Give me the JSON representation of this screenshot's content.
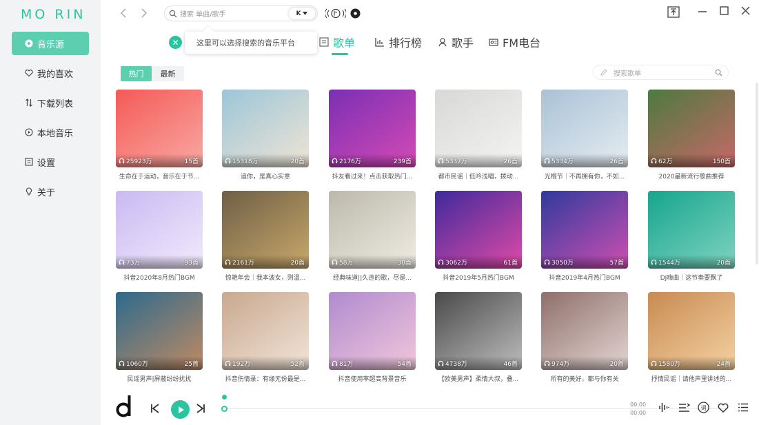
{
  "app": {
    "logo": "MO RIN"
  },
  "sidebar": {
    "items": [
      {
        "label": "音乐源",
        "icon": "disc-icon",
        "active": true
      },
      {
        "label": "我的喜欢",
        "icon": "heart-icon"
      },
      {
        "label": "下载列表",
        "icon": "sort-icon"
      },
      {
        "label": "本地音乐",
        "icon": "play-circle-icon"
      },
      {
        "label": "设置",
        "icon": "settings-icon"
      },
      {
        "label": "关于",
        "icon": "bulb-icon"
      }
    ]
  },
  "search": {
    "placeholder": "搜索 单曲/歌手",
    "source": "K"
  },
  "tooltip": {
    "text": "这里可以选择搜索的音乐平台"
  },
  "tabs": [
    {
      "label": "歌单",
      "icon": "playlist-icon",
      "active": true
    },
    {
      "label": "排行榜",
      "icon": "chart-icon"
    },
    {
      "label": "歌手",
      "icon": "singer-icon"
    },
    {
      "label": "FM电台",
      "icon": "radio-icon"
    }
  ],
  "filters": {
    "hot": "热门",
    "new": "最新"
  },
  "playlist_search": {
    "placeholder": "搜索歌单"
  },
  "playlists": [
    {
      "title": "生命在于运动，音乐在于节...",
      "plays": "25923万",
      "tracks": "15首",
      "colors": [
        "#f45a56",
        "#f9a8a3"
      ]
    },
    {
      "title": "追你，是真心实意",
      "plays": "15318万",
      "tracks": "20首",
      "colors": [
        "#9cc6d8",
        "#efe4d4"
      ]
    },
    {
      "title": "抖友看过来！点击获取热门...",
      "plays": "2176万",
      "tracks": "239首",
      "colors": [
        "#7b2fb3",
        "#d44ab5"
      ]
    },
    {
      "title": "都市民谣｜低吟浅唱，拨动...",
      "plays": "5337万",
      "tracks": "26首",
      "colors": [
        "#d8d8d6",
        "#f4f4f2"
      ]
    },
    {
      "title": "光棍节｜不再拥有你，不如...",
      "plays": "5334万",
      "tracks": "26首",
      "colors": [
        "#a9c2d6",
        "#e6ecf1"
      ]
    },
    {
      "title": "2020最新流行歌曲推荐",
      "plays": "62万",
      "tracks": "150首",
      "colors": [
        "#4c7a3e",
        "#c86868"
      ]
    },
    {
      "title": "抖音2020年8月热门BGM",
      "plays": "73万",
      "tracks": "93首",
      "colors": [
        "#c9b9f2",
        "#f2eafc"
      ]
    },
    {
      "title": "惊艳年会｜我本波女，则温...",
      "plays": "2161万",
      "tracks": "20首",
      "colors": [
        "#6e5f46",
        "#c9a86a"
      ]
    },
    {
      "title": "经典味道||久违的歌，尽是...",
      "plays": "58万",
      "tracks": "30首",
      "colors": [
        "#bcb9ac",
        "#efece2"
      ]
    },
    {
      "title": "抖音2019年5月热门BGM",
      "plays": "3062万",
      "tracks": "61首",
      "colors": [
        "#3f2a9a",
        "#e04aa8"
      ]
    },
    {
      "title": "抖音2019年4月热门BGM",
      "plays": "3050万",
      "tracks": "57首",
      "colors": [
        "#2f3a9c",
        "#cf4fb2"
      ]
    },
    {
      "title": "DJ嗨曲｜这节奏要飘了",
      "plays": "1544万",
      "tracks": "20首",
      "colors": [
        "#16a58d",
        "#7fd3c0"
      ]
    },
    {
      "title": "民谣男声|屏蔽纷纷扰扰",
      "plays": "1060万",
      "tracks": "25首",
      "colors": [
        "#2d6a8c",
        "#c08a63"
      ]
    },
    {
      "title": "抖音伤情录：有缘无份最是...",
      "plays": "192万",
      "tracks": "52首",
      "colors": [
        "#c9a88f",
        "#f1e4d8"
      ]
    },
    {
      "title": "抖音使用率超高背景音乐",
      "plays": "81万",
      "tracks": "54首",
      "colors": [
        "#b08bcf",
        "#f1c7da"
      ]
    },
    {
      "title": "【欧美男声】柔情大叔，叠...",
      "plays": "4738万",
      "tracks": "46首",
      "colors": [
        "#4a4a4a",
        "#bdbdbd"
      ]
    },
    {
      "title": "所有的美好，都与你有关",
      "plays": "974万",
      "tracks": "20首",
      "colors": [
        "#8f6f6a",
        "#e3d6d3"
      ]
    },
    {
      "title": "抒情民谣｜请他声里讲述的...",
      "plays": "1580万",
      "tracks": "24首",
      "colors": [
        "#c98a52",
        "#f3d2a2"
      ]
    }
  ],
  "player": {
    "current_time": "00:00",
    "total_time": "00:00"
  },
  "colors": {
    "accent": "#2bc4a0"
  }
}
